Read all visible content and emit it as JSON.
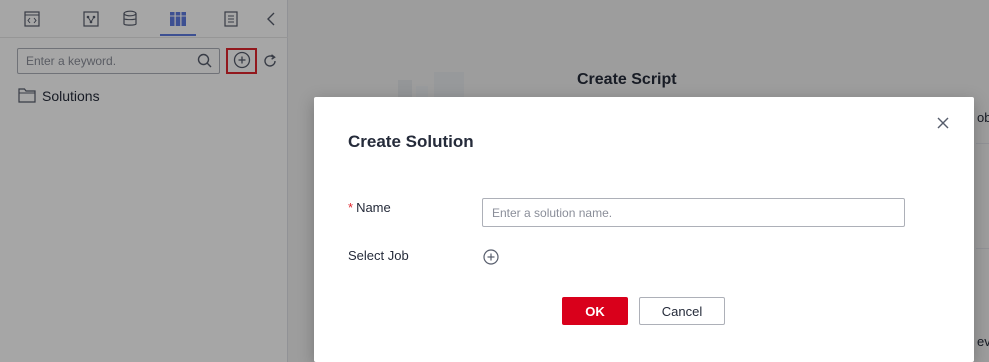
{
  "toolbar": {
    "tabs": [
      {
        "icon": "code-icon",
        "active": false
      },
      {
        "icon": "diagram-icon",
        "active": false
      },
      {
        "icon": "database-icon",
        "active": false
      },
      {
        "icon": "solutions-icon",
        "active": true
      },
      {
        "icon": "document-icon",
        "active": false
      }
    ],
    "collapse_icon": "chevron-left-icon"
  },
  "search": {
    "placeholder": "Enter a keyword.",
    "value": ""
  },
  "tree": {
    "items": [
      {
        "label": "Solutions",
        "icon": "folder-icon"
      }
    ]
  },
  "background": {
    "title": "Create Script",
    "fragments": [
      "ob",
      "eve"
    ]
  },
  "modal": {
    "title": "Create Solution",
    "name_required_mark": "*",
    "name_label": "Name",
    "name_placeholder": "Enter a solution name.",
    "name_value": "",
    "select_job_label": "Select Job",
    "ok_label": "OK",
    "cancel_label": "Cancel"
  },
  "colors": {
    "accent": "#5e7ce0",
    "primary_button": "#d9001b",
    "highlight_border": "#e1252d"
  }
}
